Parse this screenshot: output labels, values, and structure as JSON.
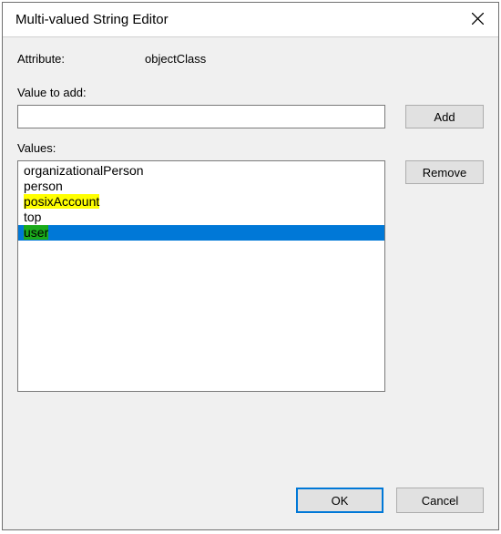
{
  "window": {
    "title": "Multi-valued String Editor"
  },
  "attribute": {
    "label": "Attribute:",
    "value": "objectClass"
  },
  "value_to_add": {
    "label": "Value to add:",
    "input_value": ""
  },
  "buttons": {
    "add": "Add",
    "remove": "Remove",
    "ok": "OK",
    "cancel": "Cancel"
  },
  "values": {
    "label": "Values:",
    "items": [
      {
        "text": "organizationalPerson",
        "highlight": "none",
        "selected": false
      },
      {
        "text": "person",
        "highlight": "none",
        "selected": false
      },
      {
        "text": "posixAccount",
        "highlight": "yellow",
        "selected": false
      },
      {
        "text": "top",
        "highlight": "none",
        "selected": false
      },
      {
        "text": "user",
        "highlight": "green",
        "selected": true
      }
    ]
  }
}
